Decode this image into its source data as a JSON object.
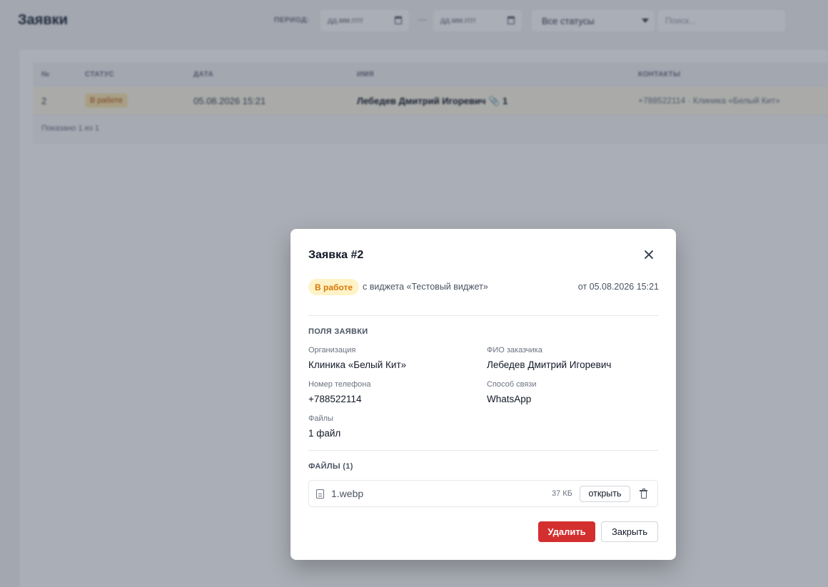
{
  "header": {
    "title": "Заявки",
    "period_label": "ПЕРИОД:",
    "date_from_placeholder": "дд.мм.гггг",
    "date_separator": "—",
    "date_to_placeholder": "дд.мм.гггг",
    "status_filter": "Все статусы",
    "search_placeholder": "Поиск..."
  },
  "table": {
    "columns": [
      "№",
      "СТАТУС",
      "ДАТА",
      "ИМЯ",
      "КОНТАКТЫ"
    ],
    "rows": [
      {
        "num": "2",
        "status": "В работе",
        "date": "05.08.2026 15:21",
        "name": "Лебедев Дмитрий Игоревич  📎 1",
        "contacts": "+788522114 · Клиника «Белый Кит»"
      }
    ],
    "footer": "Показано 1 из 1"
  },
  "modal": {
    "title": "Заявка #2",
    "status": "В работе",
    "source": "с виджета «Тестовый виджет»",
    "date": "от 05.08.2026 15:21",
    "fields_title": "ПОЛЯ ЗАЯВКИ",
    "fields": [
      {
        "label": "Организация",
        "value": "Клиника «Белый Кит»"
      },
      {
        "label": "ФИО заказчика",
        "value": "Лебедев Дмитрий Игоревич"
      },
      {
        "label": "Номер телефона",
        "value": "+788522114"
      },
      {
        "label": "Способ связи",
        "value": "WhatsApp"
      },
      {
        "label": "Файлы",
        "value": "1 файл"
      }
    ],
    "files_title": "ФАЙЛЫ (1)",
    "files": [
      {
        "name": "1.webp",
        "size": "37 КБ",
        "open_label": "открыть"
      }
    ],
    "delete_label": "Удалить",
    "close_label": "Закрыть"
  },
  "colors": {
    "danger": "#d42f2f",
    "status_badge_bg": "#fef3c7",
    "status_badge_text": "#d97706"
  }
}
